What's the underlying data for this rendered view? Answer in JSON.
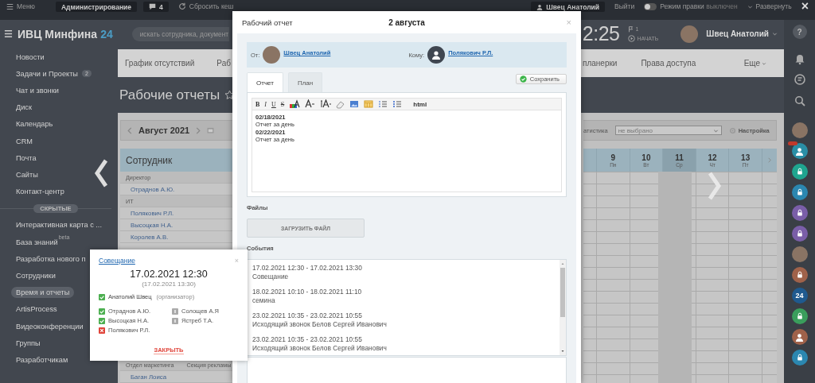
{
  "top_bar": {
    "menu": "Меню",
    "admin_button": "Администрирование",
    "counter": "4",
    "reset_cache": "Сбросить кеш",
    "user_button": "Швец Анатолий",
    "logout": "Выйти",
    "edit_mode": {
      "label": "Режим правки",
      "state_text": "выключен",
      "on": false
    },
    "expand": "Развернуть",
    "close": "×"
  },
  "header": {
    "logo": "ИВЦ Минфина",
    "logo_suffix": "24",
    "search": {
      "placeholder": "искать сотрудника, документ"
    },
    "clock": "2:25",
    "flag_count": "1",
    "start": "НАЧАТЬ",
    "user": "Швец Анатолий"
  },
  "sidebar": {
    "items": [
      {
        "label": "Новости",
        "selected": false
      },
      {
        "label": "Задачи и Проекты",
        "counter": "2",
        "selected": false
      },
      {
        "label": "Чат и звонки",
        "selected": false
      },
      {
        "label": "Диск",
        "selected": false
      },
      {
        "label": "Календарь",
        "selected": false
      },
      {
        "label": "CRM",
        "selected": false
      },
      {
        "label": "Почта",
        "selected": false
      },
      {
        "label": "Сайты",
        "selected": false
      },
      {
        "label": "Контакт-центр",
        "selected": false
      }
    ],
    "hidden_label": "СКРЫТЫЕ",
    "hidden_items": [
      {
        "label": "Интерактивная карта с ...",
        "selected": false
      },
      {
        "label": "База знаний",
        "sup": "beta",
        "selected": false
      },
      {
        "label": "Разработка нового п",
        "selected": false
      },
      {
        "label": "Сотрудники",
        "selected": false
      },
      {
        "label": "Время и отчеты",
        "selected": true
      },
      {
        "label": "ArtisProcess",
        "selected": false
      },
      {
        "label": "Видеоконференции",
        "selected": false
      },
      {
        "label": "Группы",
        "selected": false
      },
      {
        "label": "Разработчикам",
        "selected": false
      }
    ]
  },
  "main": {
    "tabs_left": [
      "График отсутствий",
      "Раб"
    ],
    "tabs_right": [
      "планерки",
      "Права доступа"
    ],
    "more": "Еще",
    "page_title": "Рабочие отчеты",
    "calendar": {
      "month": "Август 2021",
      "stat_label": "атистика",
      "filter": {
        "value": "не выбрано"
      },
      "settings": "Настройка"
    },
    "table": {
      "first_column": "Сотрудник",
      "days": [
        {
          "day": "9",
          "weekday": "Пн",
          "today": false
        },
        {
          "day": "10",
          "weekday": "Вт",
          "today": false
        },
        {
          "day": "11",
          "weekday": "Ср",
          "today": true
        },
        {
          "day": "12",
          "weekday": "Чт",
          "today": false
        },
        {
          "day": "13",
          "weekday": "Пт",
          "today": false
        }
      ],
      "rows": [
        {
          "kind": "group",
          "label": "Директор"
        },
        {
          "kind": "person",
          "label": "Отраднов А.Ю."
        },
        {
          "kind": "group",
          "label": "ИТ"
        },
        {
          "kind": "person",
          "label": "Полякович Р.Л."
        },
        {
          "kind": "person",
          "label": "Высоцкая Н.А."
        },
        {
          "kind": "person",
          "label": "Королев А.В."
        }
      ],
      "bottom_rows": [
        {
          "kind": "group",
          "label": "Отдел маркетинга",
          "subgroup": "Секция рекламы"
        },
        {
          "kind": "person",
          "label": "Баган Лоиса"
        }
      ]
    }
  },
  "modal": {
    "title": "Рабочий отчет",
    "date": "2 августа",
    "close": "×",
    "parties": [
      {
        "kind": "photo",
        "label": "От:",
        "name": "Швец Анатолий"
      },
      {
        "kind": "silhouette",
        "label": "Кому:",
        "name": "Полякович Р.Л."
      }
    ],
    "tabs": [
      {
        "label": "Отчет",
        "selected": true
      },
      {
        "label": "План",
        "selected": false
      }
    ],
    "save": "Сохранить",
    "toolbar": [
      {
        "kind": "bold",
        "label": "B"
      },
      {
        "kind": "italic",
        "label": "I"
      },
      {
        "kind": "underline",
        "label": "U"
      },
      {
        "kind": "strike",
        "label": "S"
      },
      {
        "kind": "bgcolor"
      },
      {
        "kind": "fontsize"
      },
      {
        "kind": "fontcolor"
      },
      {
        "kind": "eraser"
      },
      {
        "kind": "image"
      },
      {
        "kind": "table"
      },
      {
        "kind": "ol"
      },
      {
        "kind": "ul"
      },
      {
        "kind": "html",
        "label": "html"
      }
    ],
    "editor_lines": [
      {
        "text": "02/18/2021",
        "bold": true
      },
      {
        "text": "Отчет за день",
        "bold": false
      },
      {
        "text": "02/22/2021",
        "bold": true
      },
      {
        "text": "Отчет за день",
        "bold": false
      }
    ],
    "files_label": "Файлы",
    "upload": "ЗАГРУЗИТЬ ФАЙЛ",
    "events_label": "События",
    "events": [
      {
        "time": "17.02.2021 12:30 - 17.02.2021 13:30",
        "title": "Совещание"
      },
      {
        "time": "18.02.2021 10:10 - 18.02.2021 11:10",
        "title": "семина"
      },
      {
        "time": "23.02.2021 10:35 - 23.02.2021 10:55",
        "title": "Исходящий звонок Белов Сергей Иванович"
      },
      {
        "time": "23.02.2021 10:35 - 23.02.2021 10:55",
        "title": "Исходящий звонок Белов Сергей Иванович"
      }
    ]
  },
  "popup": {
    "title": "Совещание",
    "close": "×",
    "start": "17.02.2021 12:30",
    "end": "(17.02.2021 13:30)",
    "organizer": {
      "name": "Анатолий Швец",
      "role": "(организатор)",
      "accepted": true,
      "declined": false
    },
    "attendees": [
      {
        "name": "Отраднов А.Ю.",
        "accepted": true,
        "declined": false
      },
      {
        "name": "Солощев А.Я",
        "accepted": false,
        "declined": false
      },
      {
        "name": "Высоцкая Н.А.",
        "accepted": true,
        "declined": false
      },
      {
        "name": "Ястреб Т.А.",
        "accepted": false,
        "declined": false
      },
      {
        "name": "Полякович Р.Л.",
        "accepted": false,
        "declined": true
      }
    ],
    "close_button": "ЗАКРЫТЬ"
  },
  "rail": {
    "help": "?",
    "tools": [
      {
        "kind": "bell"
      },
      {
        "kind": "chat"
      },
      {
        "kind": "search"
      }
    ],
    "contacts": [
      {
        "kind": "photo",
        "badge": false
      },
      {
        "kind": "user",
        "color": "#2a8fa6",
        "badge": true
      },
      {
        "kind": "lock",
        "color": "#1fa58f",
        "badge": false
      },
      {
        "kind": "lock",
        "color": "#2b87b0",
        "badge": false
      },
      {
        "kind": "lock",
        "color": "#7a5ea8",
        "badge": false
      },
      {
        "kind": "lock",
        "color": "#7a5ea8",
        "badge": false
      },
      {
        "kind": "photo",
        "badge": false
      },
      {
        "kind": "lock",
        "color": "#a0624a",
        "badge": false
      },
      {
        "kind": "logo",
        "label": "24",
        "color": "#1f5a8f",
        "badge": false
      },
      {
        "kind": "lock",
        "color": "#3a9e5c",
        "badge": false
      },
      {
        "kind": "user",
        "color": "#a0624a",
        "badge": false
      },
      {
        "kind": "lock",
        "color": "#2b87b0",
        "badge": false
      }
    ]
  }
}
